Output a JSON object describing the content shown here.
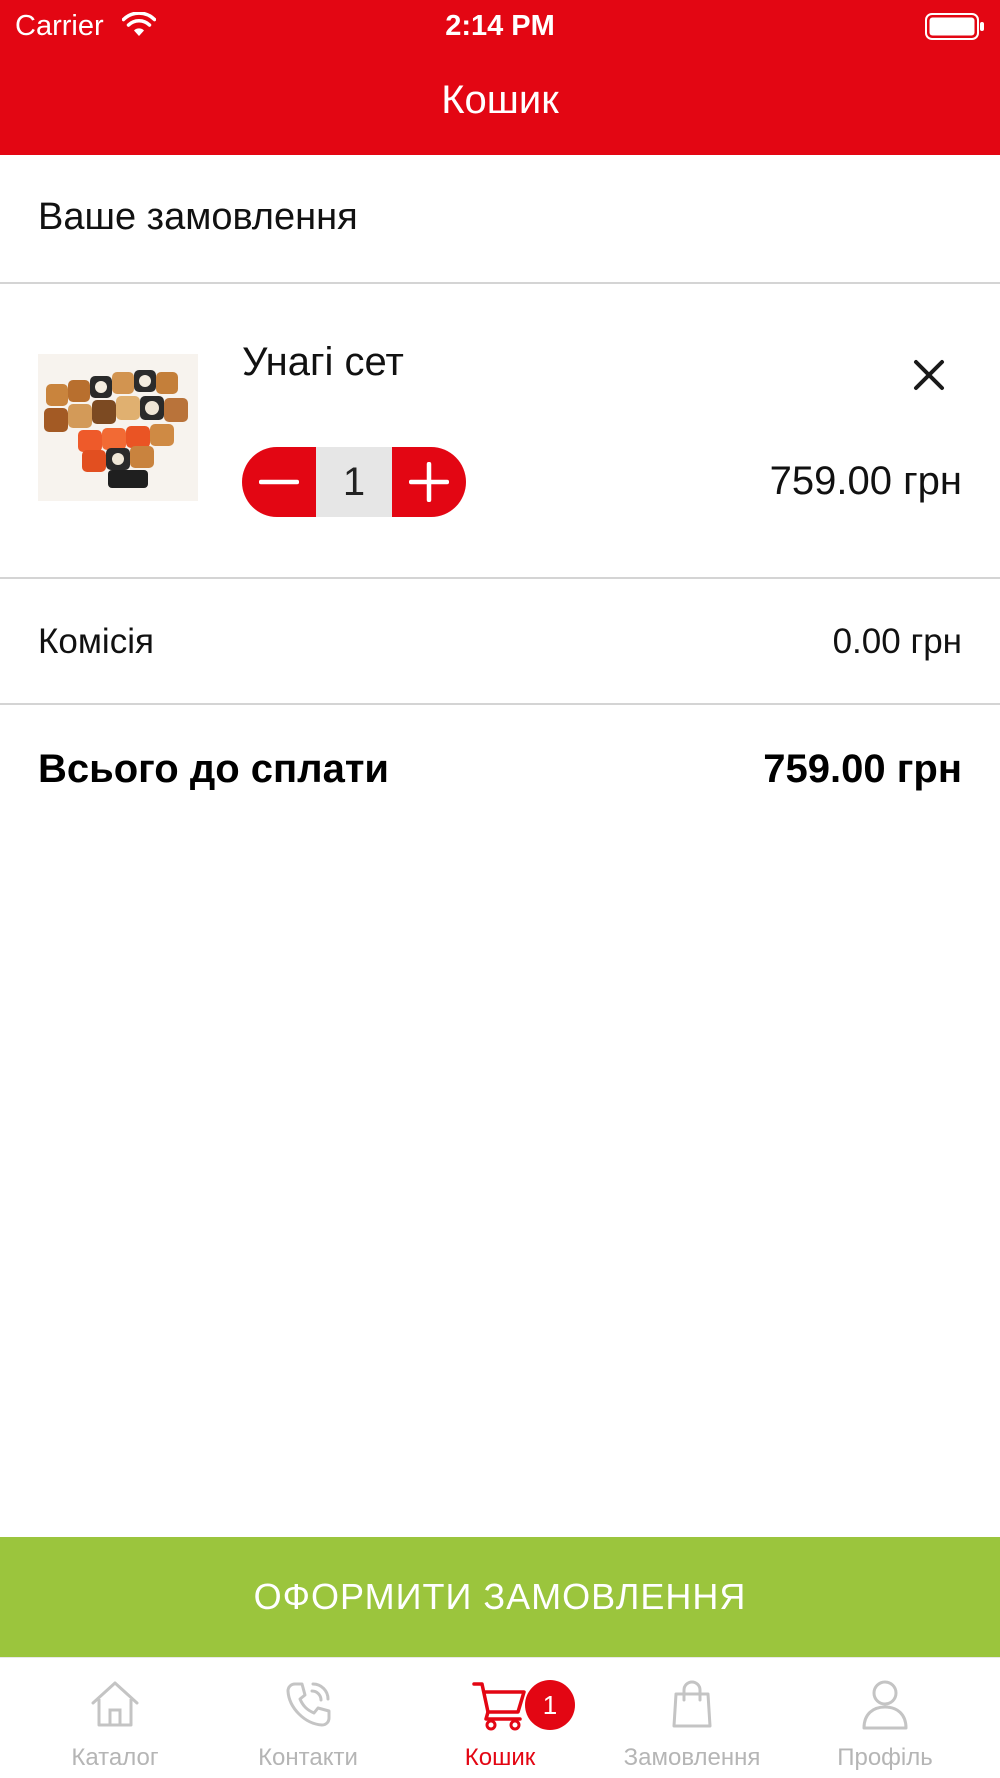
{
  "status_bar": {
    "carrier": "Carrier",
    "time": "2:14 PM"
  },
  "header": {
    "title": "Кошик"
  },
  "order": {
    "heading": "Ваше замовлення",
    "items": [
      {
        "name": "Унагі сет",
        "quantity": "1",
        "price": "759.00 грн"
      }
    ]
  },
  "summary": {
    "commission_label": "Комісія",
    "commission_value": "0.00 грн",
    "total_label": "Всього до сплати",
    "total_value": "759.00 грн"
  },
  "checkout": {
    "label": "ОФОРМИТИ ЗАМОВЛЕННЯ"
  },
  "tabbar": {
    "tabs": [
      {
        "label": "Каталог",
        "icon": "home-icon"
      },
      {
        "label": "Контакти",
        "icon": "phone-icon"
      },
      {
        "label": "Кошик",
        "icon": "cart-icon",
        "active": true,
        "badge": "1"
      },
      {
        "label": "Замовлення",
        "icon": "shopping-bag-icon"
      },
      {
        "label": "Профіль",
        "icon": "user-icon"
      }
    ]
  },
  "colors": {
    "brand_red": "#e30613",
    "checkout_green": "#9bc53d",
    "inactive_tab": "#b5b5b5",
    "divider": "#d4d4d4"
  }
}
